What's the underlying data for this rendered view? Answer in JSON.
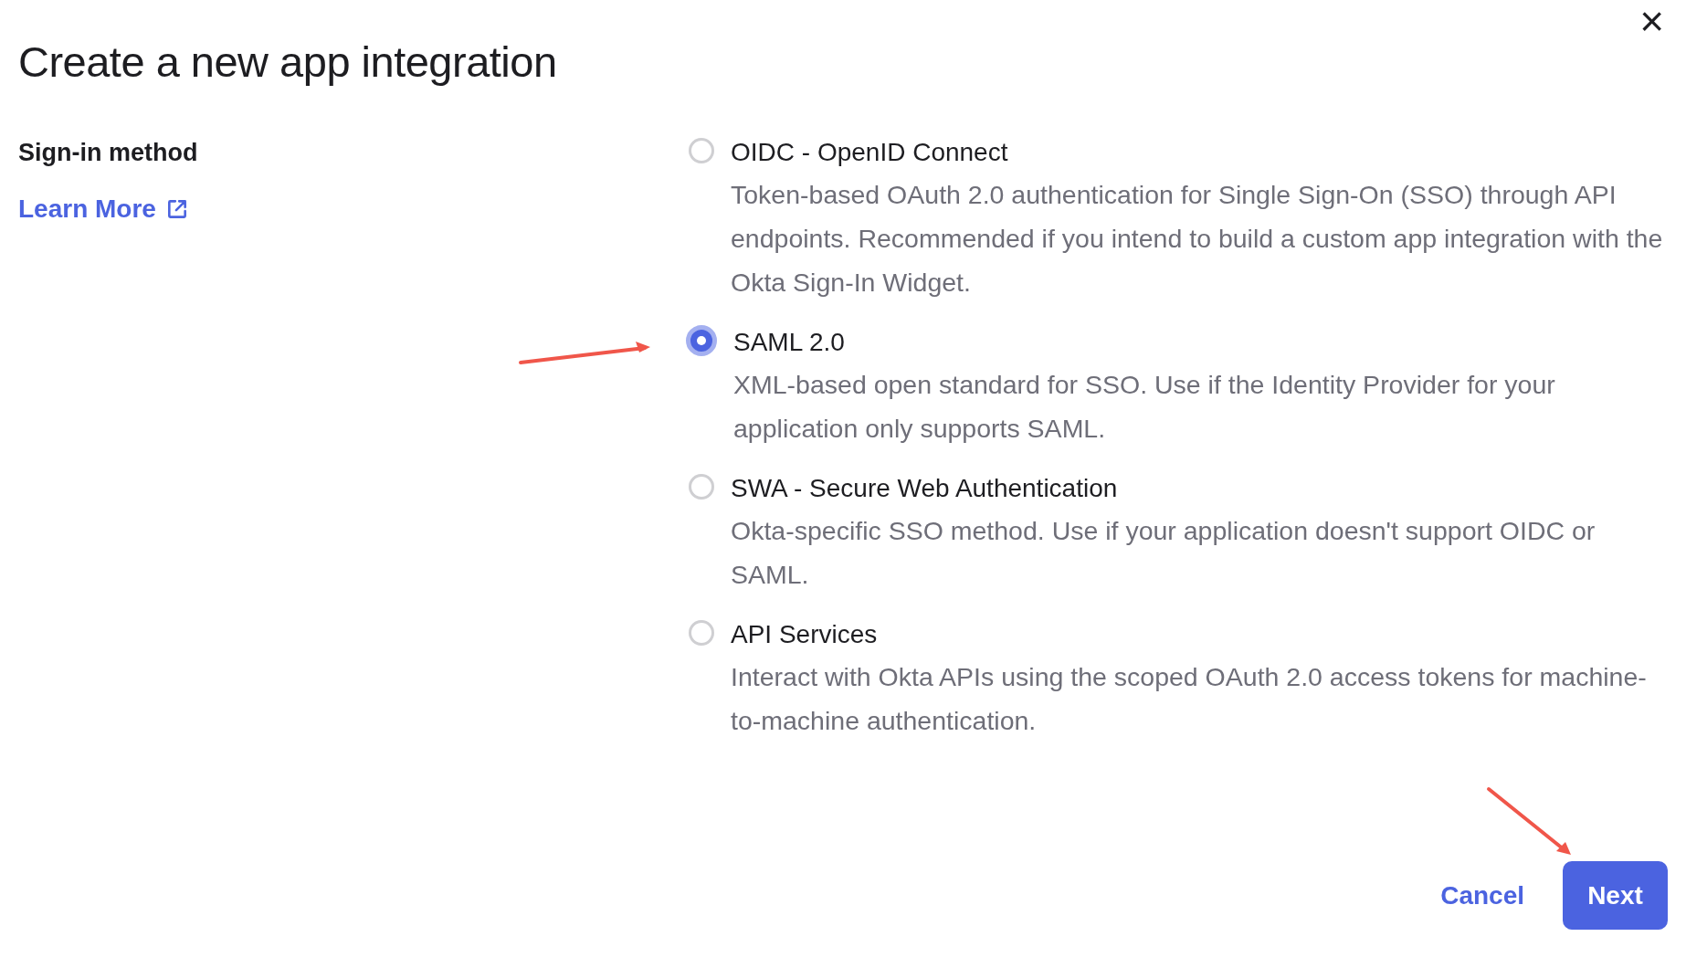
{
  "dialog": {
    "title": "Create a new app integration",
    "close": "×"
  },
  "sign_in": {
    "label": "Sign-in method",
    "link": "Learn More"
  },
  "options": [
    {
      "title": "OIDC - OpenID Connect",
      "description": "Token-based OAuth 2.0 authentication for Single Sign-On (SSO) through API endpoints. Recommended if you intend to build a custom app integration with the Okta Sign-In Widget.",
      "selected": false
    },
    {
      "title": "SAML 2.0",
      "description": "XML-based open standard for SSO. Use if the Identity Provider for your application only supports SAML.",
      "selected": true
    },
    {
      "title": "SWA - Secure Web Authentication",
      "description": "Okta-specific SSO method. Use if your application doesn't support OIDC or SAML.",
      "selected": false
    },
    {
      "title": "API Services",
      "description": "Interact with Okta APIs using the scoped OAuth 2.0 access tokens for machine-to-machine authentication.",
      "selected": false
    }
  ],
  "buttons": {
    "cancel": "Cancel",
    "next": "Next"
  }
}
